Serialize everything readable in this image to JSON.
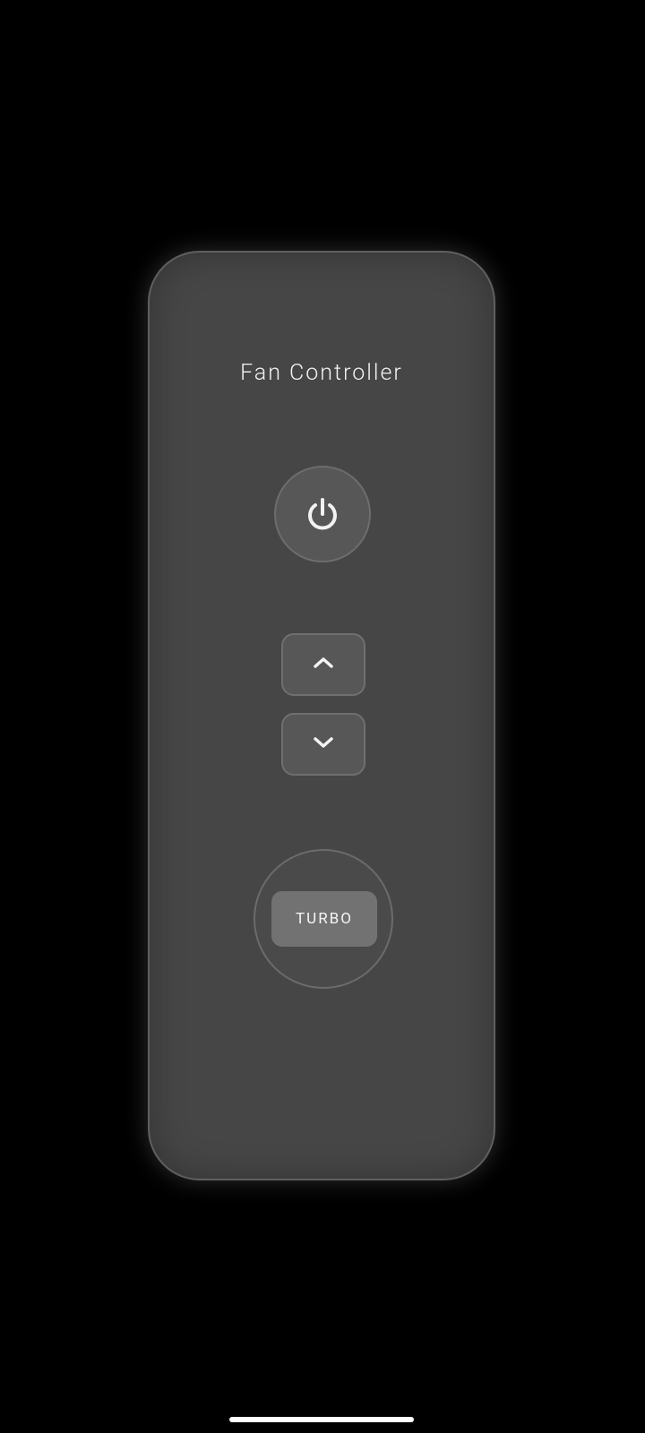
{
  "app": {
    "title": "Fan Controller"
  },
  "controls": {
    "power": {
      "icon": "power-icon"
    },
    "speed_up": {
      "icon": "chevron-up-icon"
    },
    "speed_down": {
      "icon": "chevron-down-icon"
    },
    "turbo": {
      "label": "TURBO"
    }
  },
  "colors": {
    "background": "#000000",
    "panel": "#464646",
    "button": "#575757",
    "turbo_button": "#727272",
    "text": "#f2f2f2"
  },
  "system": {
    "home_indicator": "home-indicator"
  }
}
